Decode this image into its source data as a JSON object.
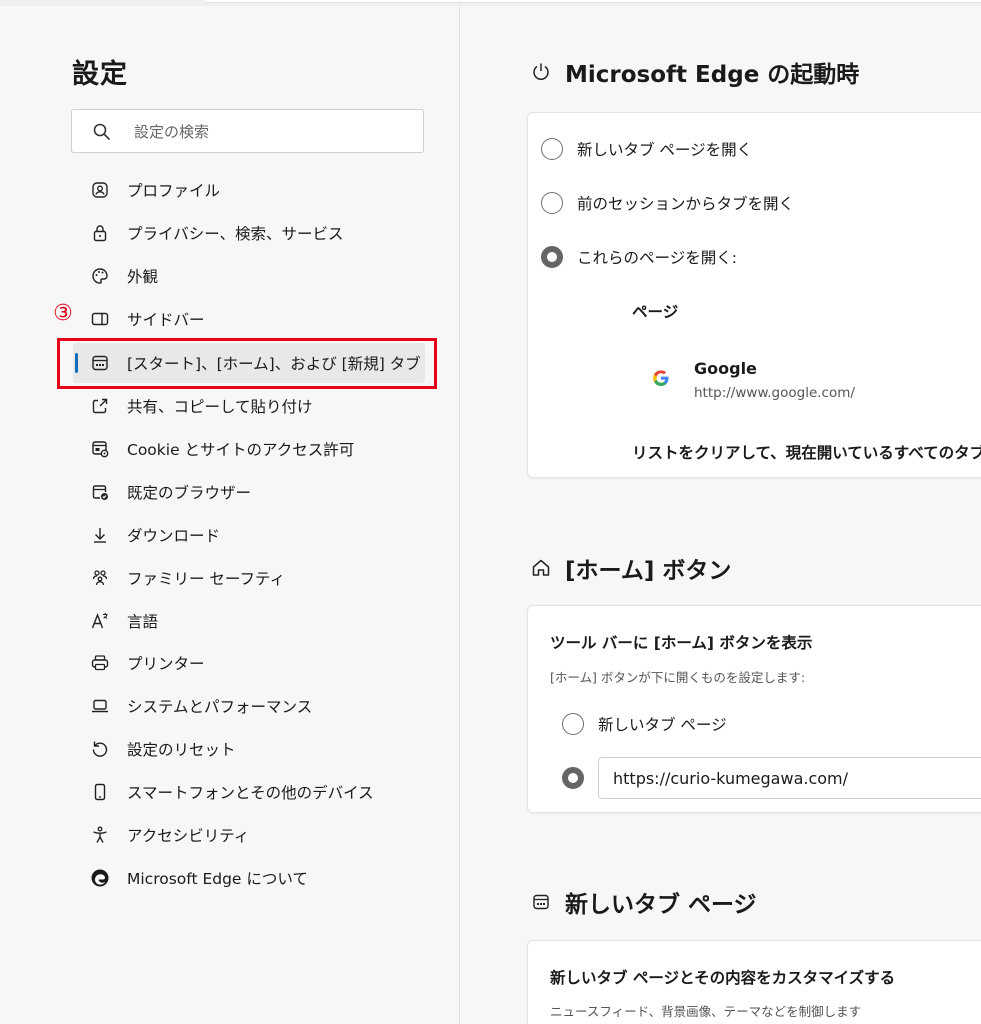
{
  "sidebar": {
    "title": "設定",
    "search_placeholder": "設定の検索",
    "annotation": "③",
    "items": [
      {
        "label": "プロファイル",
        "icon": "profile-icon"
      },
      {
        "label": "プライバシー、検索、サービス",
        "icon": "lock-icon"
      },
      {
        "label": "外観",
        "icon": "palette-icon"
      },
      {
        "label": "サイドバー",
        "icon": "sidebar-icon"
      },
      {
        "label": "[スタート]、[ホーム]、および [新規] タブ",
        "icon": "newtab-icon",
        "selected": true
      },
      {
        "label": "共有、コピーして貼り付け",
        "icon": "share-icon"
      },
      {
        "label": "Cookie とサイトのアクセス許可",
        "icon": "site-permissions-icon"
      },
      {
        "label": "既定のブラウザー",
        "icon": "default-browser-icon"
      },
      {
        "label": "ダウンロード",
        "icon": "download-icon"
      },
      {
        "label": "ファミリー セーフティ",
        "icon": "family-icon"
      },
      {
        "label": "言語",
        "icon": "language-icon"
      },
      {
        "label": "プリンター",
        "icon": "printer-icon"
      },
      {
        "label": "システムとパフォーマンス",
        "icon": "laptop-icon"
      },
      {
        "label": "設定のリセット",
        "icon": "reset-icon"
      },
      {
        "label": "スマートフォンとその他のデバイス",
        "icon": "phone-icon"
      },
      {
        "label": "アクセシビリティ",
        "icon": "accessibility-icon"
      },
      {
        "label": "Microsoft Edge について",
        "icon": "edge-logo-icon"
      }
    ]
  },
  "startup": {
    "title": "Microsoft Edge の起動時",
    "options": [
      {
        "label": "新しいタブ ページを開く",
        "selected": false
      },
      {
        "label": "前のセッションからタブを開く",
        "selected": false
      },
      {
        "label": "これらのページを開く:",
        "selected": true
      }
    ],
    "pages_header": "ページ",
    "page": {
      "name": "Google",
      "url": "http://www.google.com/"
    },
    "clear_text": "リストをクリアして、現在開いているすべてのタブに"
  },
  "home": {
    "title": "[ホーム] ボタン",
    "toggle_label": "ツール バーに [ホーム] ボタンを表示",
    "description": "[ホーム] ボタンが下に開くものを設定します:",
    "options": [
      {
        "label": "新しいタブ ページ",
        "selected": false
      }
    ],
    "url_value": "https://curio-kumegawa.com/"
  },
  "newtab": {
    "title": "新しいタブ ページ",
    "customize_label": "新しいタブ ページとその内容をカスタマイズする",
    "customize_desc": "ニュースフィード、背景画像、テーマなどを制御します"
  },
  "colors": {
    "accent": "#0f6cbd",
    "highlight": "#e6001a"
  }
}
